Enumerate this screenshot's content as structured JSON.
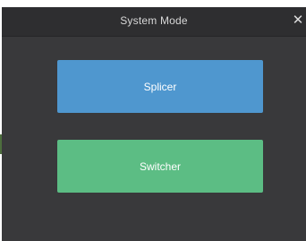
{
  "dialog": {
    "title": "System Mode",
    "close_glyph": "✕",
    "close_icon": "close-icon"
  },
  "modes": [
    {
      "label": "Splicer",
      "color": "#4f97cf"
    },
    {
      "label": "Switcher",
      "color": "#5cbd84"
    }
  ],
  "colors": {
    "dialog_background": "#39393b",
    "titlebar_background": "#2e2e30",
    "title_text": "#d8d8d8"
  }
}
